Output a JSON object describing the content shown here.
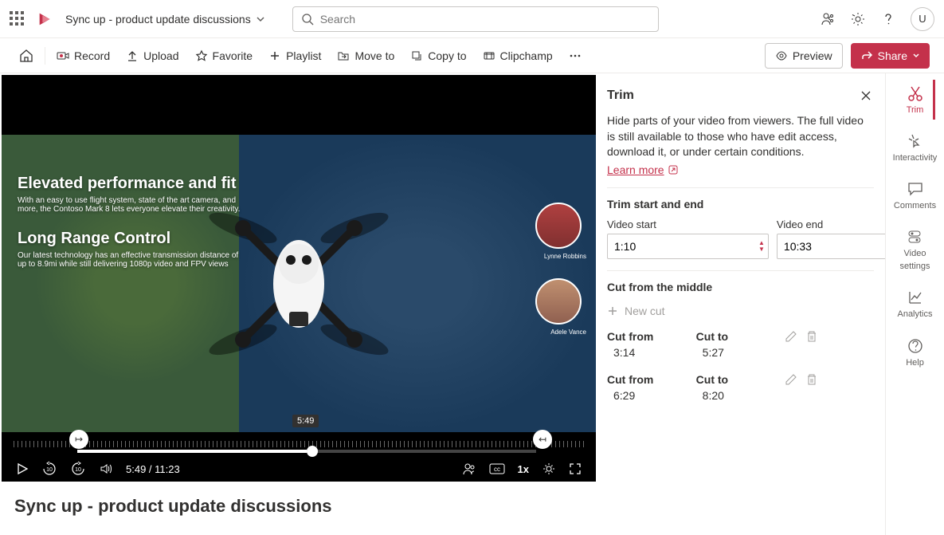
{
  "header": {
    "breadcrumb": "Sync up - product update discussions",
    "search_placeholder": "Search",
    "avatar": "U"
  },
  "toolbar": {
    "record": "Record",
    "upload": "Upload",
    "favorite": "Favorite",
    "playlist": "Playlist",
    "moveto": "Move to",
    "copyto": "Copy to",
    "clipchamp": "Clipchamp",
    "preview": "Preview",
    "share": "Share"
  },
  "video": {
    "overlay_title1": "Elevated performance and fit",
    "overlay_desc1": "With an easy to use flight system, state of the art camera, and more, the Contoso Mark 8 lets everyone elevate their creativity.",
    "overlay_title2": "Long Range Control",
    "overlay_desc2": "Our latest technology has an effective transmission distance of up to 8.9mi while still delivering 1080p video and FPV views",
    "person1": "Lynne Robbins",
    "person2": "Adele Vance",
    "tooltip": "5:49",
    "time_display": "5:49 / 11:23",
    "speed": "1x"
  },
  "title": "Sync up - product update discussions",
  "panel": {
    "heading": "Trim",
    "description": "Hide parts of your video from viewers. The full video is still available to those who have edit access, download it, or under certain conditions.",
    "learn_more": "Learn more",
    "section1": "Trim start and end",
    "start_label": "Video start",
    "start_value": "1:10",
    "end_label": "Video end",
    "end_value": "10:33",
    "section2": "Cut from the middle",
    "new_cut": "New cut",
    "cut_from": "Cut from",
    "cut_to": "Cut to",
    "cuts": [
      {
        "from": "3:14",
        "to": "5:27"
      },
      {
        "from": "6:29",
        "to": "8:20"
      }
    ]
  },
  "rail": {
    "trim": "Trim",
    "inter": "Interactivity",
    "comments": "Comments",
    "vset1": "Video",
    "vset2": "settings",
    "analytics": "Analytics",
    "help": "Help"
  }
}
